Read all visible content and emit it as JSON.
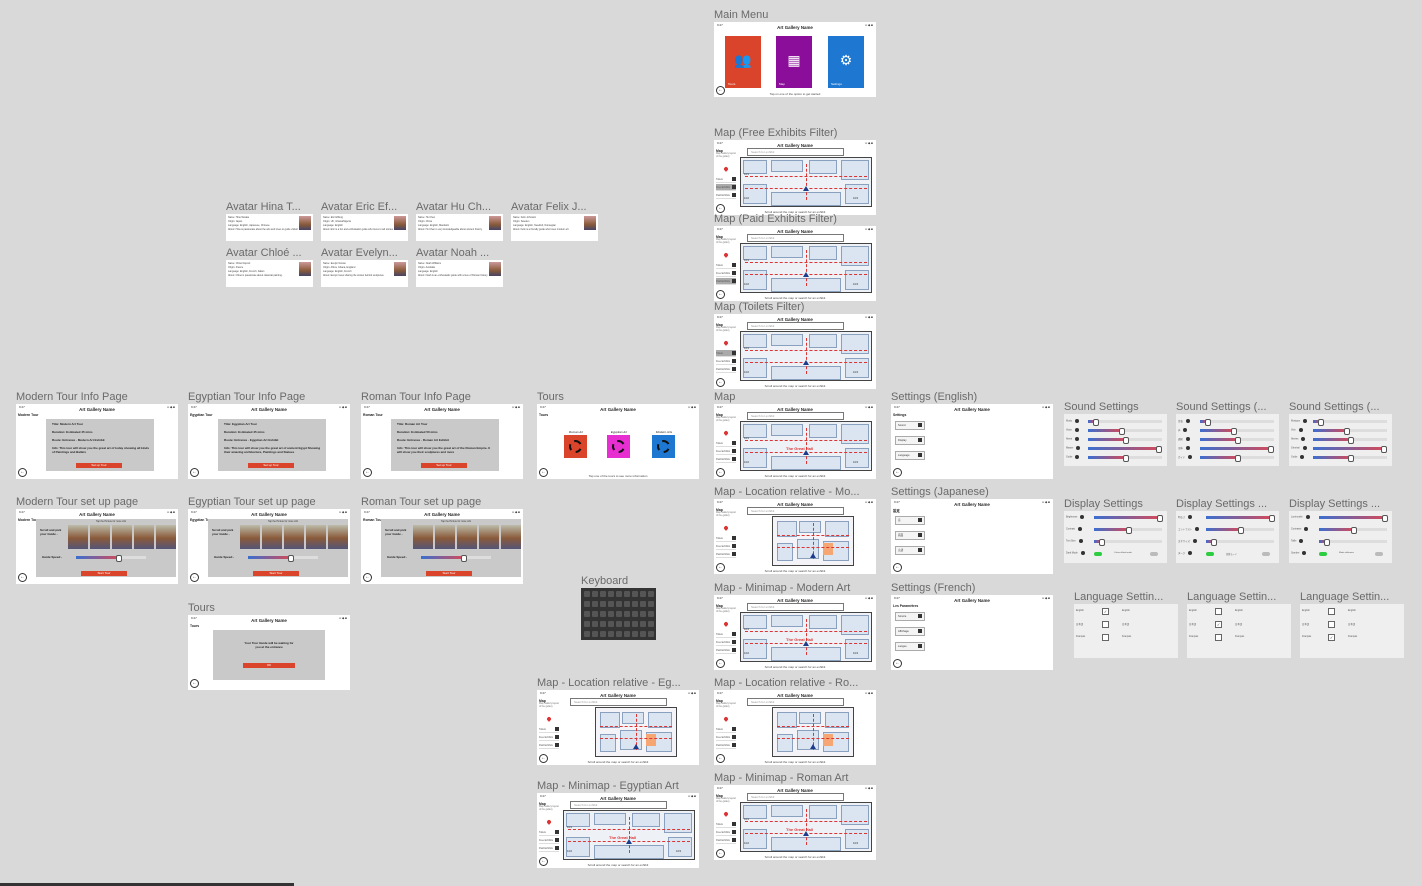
{
  "app_title": "Art Gallery Name",
  "status_time": "9:27",
  "status_icons": "▪▪ ◆ ■",
  "main_menu": {
    "title": "Main Menu",
    "tiles": [
      {
        "label": "Tours",
        "color": "#d9442b",
        "icon": "people-icon",
        "glyph": "👥"
      },
      {
        "label": "Map",
        "color": "#8a0e99",
        "icon": "map-icon",
        "glyph": "▦"
      },
      {
        "label": "Settings",
        "color": "#1e78d2",
        "icon": "gear-icon",
        "glyph": "⚙"
      }
    ],
    "caption": "Tap on one of the option to get started"
  },
  "avatars": [
    {
      "title": "Avatar Hina T...",
      "name": "Name: Hina Tanaka",
      "origin": "Origin: Japan",
      "language": "Language: English, Japanese, Chinese",
      "about": "About: Hina is passionate about the arts and loves to guide visitors through the collection."
    },
    {
      "title": "Avatar Eric Ef...",
      "name": "Name: Eric Effiong",
      "origin": "Origin: UK, Ghana/Nigeria",
      "language": "Language: English",
      "about": "About: Eric is a fun and enthusiastic guide who loves to tell stories."
    },
    {
      "title": "Avatar Hu Ch...",
      "name": "Name: Hu Chen",
      "origin": "Origin: China",
      "language": "Language: English, Mandarin",
      "about": "About: Hu Chen is very knowledgeable about ancient history."
    },
    {
      "title": "Avatar Felix J...",
      "name": "Name: Felix Johnston",
      "origin": "Origin: Sweden",
      "language": "Language: English, Swedish, Norwegian",
      "about": "About: Felix is a friendly guide who loves modern art."
    },
    {
      "title": "Avatar Chloé ...",
      "name": "Name: Chloé Dupont",
      "origin": "Origin: France",
      "language": "Language: English, French, Italian",
      "about": "About: Chloé is passionate about classical painting."
    },
    {
      "title": "Avatar Evelyn...",
      "name": "Name: Evelyn Nwosu",
      "origin": "Origin: Africa, Ghana, England",
      "language": "Language: English, French",
      "about": "About: Evelyn loves sharing the stories behind sculptures."
    },
    {
      "title": "Avatar Noah ...",
      "name": "Name: Noah Williams",
      "origin": "Origin: Australia",
      "language": "Language: English",
      "about": "About: Noah is an enthusiastic guide with a love of Roman history."
    }
  ],
  "tour_info": [
    {
      "title": "Modern Tour Info Page",
      "page": "Modern Tour",
      "lines": [
        "Title: Modern Art Tour",
        "Duration: Estimated 45 mins",
        "Route: Entrance - Modern Art Exhibit",
        "Info: This tour will show you the great art of today showing all kinds of Paintings and Ballets"
      ],
      "button": "Set up Tour"
    },
    {
      "title": "Egyptian Tour Info Page",
      "page": "Egyptian Tour",
      "lines": [
        "Title: Egyptian Art Tour",
        "Duration: Estimated 45 mins",
        "Route: Entrance - Egyptian Art Exhibit",
        "Info: This tour will show you the great art of ancient Egypt Showing their amazing architecture, Paintings and Statues"
      ],
      "button": "Set up Tour"
    },
    {
      "title": "Roman Tour Info Page",
      "page": "Roman Tour",
      "lines": [
        "Title: Roman Art Tour",
        "Duration: Estimated 50 mins",
        "Route: Entrance - Roman Art Exhibit",
        "Info: This tour will show you the great art of the Roman Empire. It will show you their sculptures and more"
      ],
      "button": "Set up Tour"
    }
  ],
  "tour_setup": [
    {
      "title": "Modern Tour set up page",
      "page": "Modern Tour",
      "pick": "Scroll and pick your Guide -",
      "speed": "Guide Speed -",
      "button": "Start Tour",
      "hint": "Tap the Picture for more info",
      "speed_level": 0.6
    },
    {
      "title": "Egyptian Tour set up page",
      "page": "Egyptian Tour",
      "pick": "Scroll and pick your Guide -",
      "speed": "Guide Speed -",
      "button": "Start Tour",
      "hint": "Tap the Picture for more info",
      "speed_level": 0.6
    },
    {
      "title": "Roman Tour set up page",
      "page": "Roman Tour",
      "pick": "Scroll and pick your Guide -",
      "speed": "Guide Speed -",
      "button": "Start Tour",
      "hint": "Tap the Picture for more info",
      "speed_level": 0.6
    }
  ],
  "tours_waiting": {
    "title": "Tours",
    "page": "Tours",
    "message": "Your Tour Guide will be waiting for you at the entrance",
    "button": "OK"
  },
  "tours": {
    "title": "Tours",
    "page": "Tours",
    "items": [
      {
        "label": "Roman Art",
        "color": "#d9442b",
        "icon": "helmet-icon"
      },
      {
        "label": "Egyptian Art",
        "color": "#e62ed1",
        "icon": "eye-icon"
      },
      {
        "label": "Modern Arts",
        "color": "#1e78d2",
        "icon": "circle-icon"
      }
    ],
    "caption": "Tap one of the tours to see more information"
  },
  "keyboard": {
    "title": "Keyboard"
  },
  "map_common": {
    "page": "Map",
    "search": "Search for exhibit",
    "side_info": "Map Gallery layout of the gallery",
    "filters": [
      "Toilets",
      "Free Exhibits",
      "Paid Exhibits"
    ],
    "caption": "Scroll around the map or search for an exhibit",
    "rooms": [
      "101",
      "102",
      "103",
      "104",
      "105"
    ],
    "hall": "The Great Hall"
  },
  "maps": [
    {
      "title": "Map (Free Exhibits Filter)",
      "selected": 1
    },
    {
      "title": "Map (Paid Exhibits Filter)",
      "selected": 2
    },
    {
      "title": "Map (Toilets Filter)",
      "selected": 0
    },
    {
      "title": "Map",
      "selected": -1
    },
    {
      "title": "Map - Location relative - Mo...",
      "selected": -1
    },
    {
      "title": "Map - Minimap - Modern Art",
      "selected": -1
    },
    {
      "title": "Map - Location relative - Ro...",
      "selected": -1
    },
    {
      "title": "Map - Minimap - Roman Art",
      "selected": -1
    },
    {
      "title": "Map - Location relative - Eg...",
      "selected": -1
    },
    {
      "title": "Map - Minimap - Egyptian Art",
      "selected": -1
    }
  ],
  "settings_screens": [
    {
      "title": "Settings (English)",
      "page": "Settings",
      "buttons": [
        "Sound",
        "Display",
        "Language"
      ]
    },
    {
      "title": "Settings (Japanese)",
      "page": "設定",
      "buttons": [
        "音",
        "画面",
        "言語"
      ]
    },
    {
      "title": "Settings (French)",
      "page": "Les Paramètres",
      "buttons": [
        "Sonore",
        "Affichage",
        "Langue"
      ]
    }
  ],
  "sound_settings": [
    {
      "title": "Sound Settings",
      "rows": [
        "Music",
        "Voice",
        "Alerts",
        "Master",
        "Guide"
      ],
      "levels": [
        0.1,
        0.45,
        0.5,
        0.95,
        0.5
      ]
    },
    {
      "title": "Sound Settings (...",
      "rows": [
        "音楽",
        "声",
        "通知",
        "全体",
        "ガイド"
      ],
      "levels": [
        0.1,
        0.45,
        0.5,
        0.95,
        0.5
      ]
    },
    {
      "title": "Sound Settings (...",
      "rows": [
        "Musique",
        "Voix",
        "Alertes",
        "Général",
        "Guide"
      ],
      "levels": [
        0.1,
        0.45,
        0.5,
        0.95,
        0.5
      ]
    }
  ],
  "display_settings": [
    {
      "title": "Display Settings",
      "rows": [
        "Brightness",
        "Contrast",
        "Text Size",
        "Dark Mode"
      ],
      "levels": [
        0.95,
        0.5,
        0.1
      ],
      "toggle_label": "Colour-blind mode"
    },
    {
      "title": "Display Settings ...",
      "rows": [
        "明るさ",
        "コントラスト",
        "文字サイズ",
        "ダーク"
      ],
      "levels": [
        0.95,
        0.5,
        0.1
      ],
      "toggle_label": "色覚モード"
    },
    {
      "title": "Display Settings ...",
      "rows": [
        "Luminosité",
        "Contraste",
        "Taille",
        "Sombre"
      ],
      "levels": [
        0.95,
        0.5,
        0.1
      ],
      "toggle_label": "Mode daltonien"
    }
  ],
  "language_settings": [
    {
      "title": "Language Settin...",
      "langs": [
        "English",
        "日本語",
        "Français"
      ],
      "checked": 0
    },
    {
      "title": "Language Settin...",
      "langs": [
        "English",
        "日本語",
        "Français"
      ],
      "checked": 1
    },
    {
      "title": "Language Settin...",
      "langs": [
        "English",
        "日本語",
        "Français"
      ],
      "checked": 2
    }
  ]
}
